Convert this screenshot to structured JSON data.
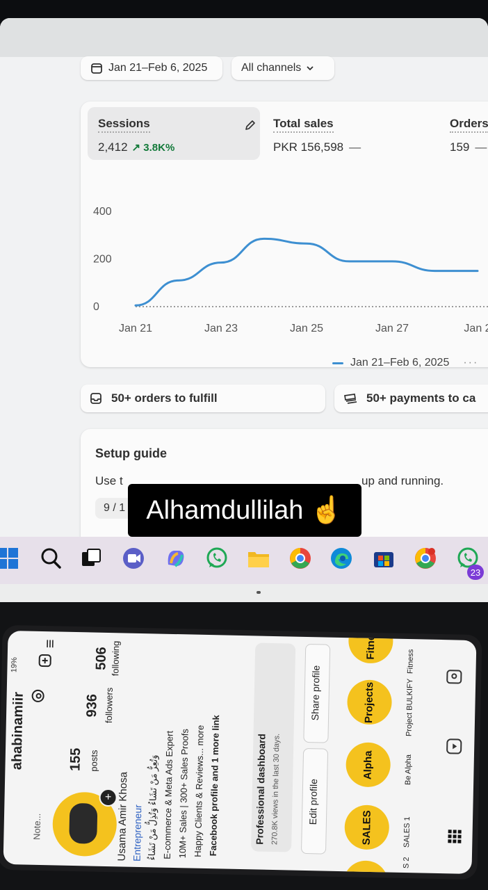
{
  "dashboard": {
    "date_range": "Jan 21–Feb 6, 2025",
    "channels_filter": "All channels",
    "metrics": {
      "sessions": {
        "label": "Sessions",
        "value": "2,412",
        "delta": "3.8K%"
      },
      "total_sales": {
        "label": "Total sales",
        "value": "PKR 156,598"
      },
      "orders": {
        "label": "Orders",
        "value": "159"
      }
    },
    "legend_label": "Jan 21–Feb 6, 2025",
    "legend_more": "···",
    "tasks": {
      "orders_to_fulfill": "50+ orders to fulfill",
      "payments_to_capture": "50+ payments to ca"
    },
    "setup_guide": {
      "title": "Setup guide",
      "description_start": "Use t",
      "description_end": "up and running.",
      "progress": "9 / 1"
    }
  },
  "chart_data": {
    "type": "line",
    "x": [
      "Jan 21",
      "Jan 22",
      "Jan 23",
      "Jan 24",
      "Jan 25",
      "Jan 26",
      "Jan 27",
      "Jan 28",
      "Jan 29"
    ],
    "xticks": [
      "Jan 21",
      "Jan 23",
      "Jan 25",
      "Jan 27",
      "Jan 2"
    ],
    "series": [
      {
        "values": [
          5,
          110,
          185,
          285,
          265,
          190,
          190,
          150,
          150
        ]
      }
    ],
    "ylim": [
      0,
      400
    ],
    "yticks": [
      "400",
      "200",
      "0"
    ],
    "grid": false,
    "legend": "bottom-right"
  },
  "taskbar": {
    "badge_count": "23",
    "icons": [
      "windows-start-icon",
      "search-icon",
      "task-view-icon",
      "meet-icon",
      "copilot-icon",
      "whatsapp-icon",
      "file-explorer-icon",
      "chrome-icon",
      "edge-icon",
      "microsoft-store-icon",
      "chrome-profile-icon",
      "whatsapp-business-icon"
    ]
  },
  "caption": {
    "text": "Alhamdullilah",
    "emoji": "☝️"
  },
  "phone": {
    "status": "19%",
    "username": "ahabinamiir",
    "note": "Note...",
    "stats": [
      {
        "count": "155",
        "label": "posts"
      },
      {
        "count": "936",
        "label": "followers"
      },
      {
        "count": "506",
        "label": "following"
      }
    ],
    "bio": {
      "name": "Usama Amir Khosa",
      "category": "Entrepreneur",
      "arabic": "وَتُعِزُّ مَنْ تَشَاءُ وَتُذِلُّ مَنْ تَشَاءُ",
      "line1": "E-commerce & Meta Ads Expert",
      "line2": "10M+ Sales | 300+ Sales Proofs",
      "line3": "Happy Clients & Reviews... more",
      "link": "Facebook profile and 1 more link"
    },
    "dashboard": {
      "title": "Professional dashboard",
      "subtitle": "270.8K views in the last 30 days."
    },
    "buttons": {
      "edit": "Edit profile",
      "share": "Share profile"
    },
    "highlights": [
      {
        "circle": "SALES",
        "label": "SALES 1"
      },
      {
        "circle": "Alpha",
        "label": "Be Alpha"
      },
      {
        "circle": "Projects",
        "label": "Project BULKIFY"
      },
      {
        "circle": "Fitness",
        "label": "Fitness"
      }
    ],
    "partial_highlight": {
      "circle": "ES",
      "label": "S 2"
    }
  }
}
